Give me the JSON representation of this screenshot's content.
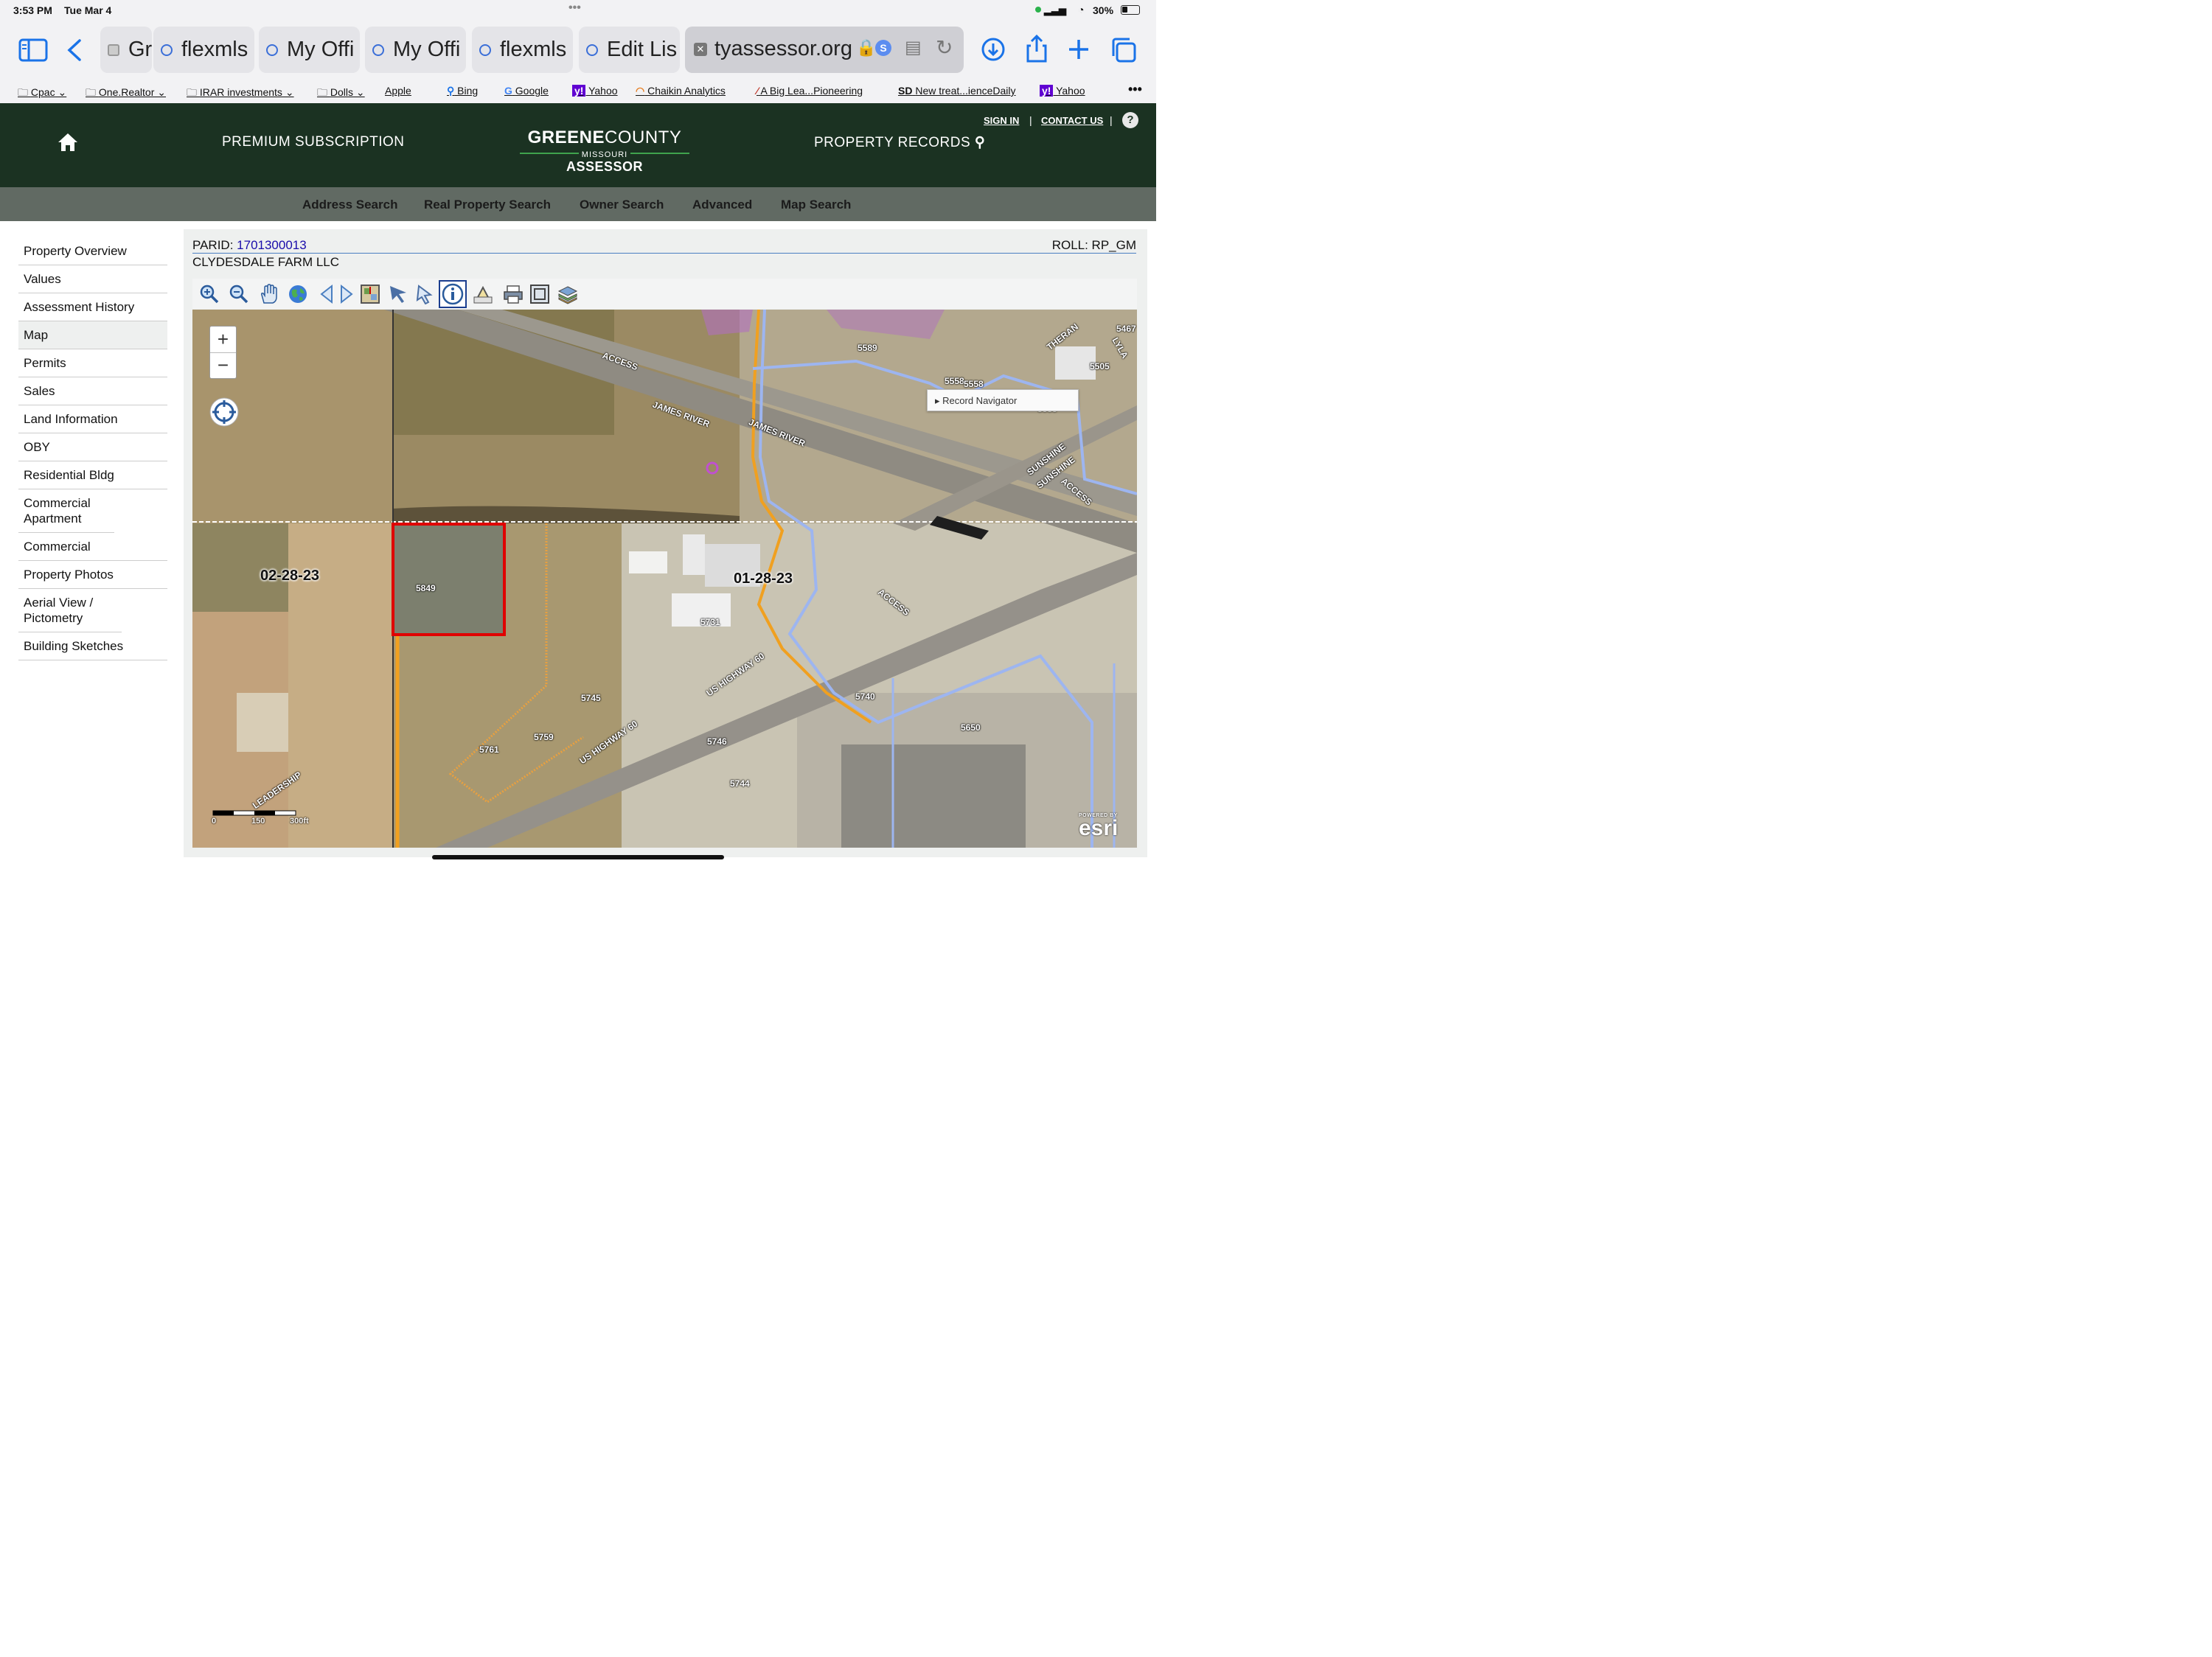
{
  "status_bar": {
    "time": "3:53 PM",
    "date": "Tue Mar 4",
    "battery": "30%"
  },
  "tabs": [
    {
      "label": "Gr"
    },
    {
      "label": "flexmls"
    },
    {
      "label": "My Offi"
    },
    {
      "label": "My Offi"
    },
    {
      "label": "flexmls"
    },
    {
      "label": "Edit Lis"
    },
    {
      "label": "tyassessor.org"
    }
  ],
  "bookmarks": [
    "Cpac",
    "One.Realtor",
    "IRAR investments",
    "Dolls",
    "Apple",
    "Bing",
    "Google",
    "Yahoo",
    "Chaikin Analytics",
    "A Big Lea...Pioneering",
    "New treat...ienceDaily",
    "Yahoo"
  ],
  "header": {
    "premium": "PREMIUM SUBSCRIPTION",
    "logo_green": "GREENE",
    "logo_county": "COUNTY",
    "logo_state": "MISSOURI",
    "logo_sub": "ASSESSOR",
    "property_records": "PROPERTY RECORDS",
    "sign_in": "SIGN IN",
    "sep": "|",
    "contact": "CONTACT US",
    "help": "?"
  },
  "subnav": [
    "Address Search",
    "Real Property Search",
    "Owner Search",
    "Advanced",
    "Map Search"
  ],
  "sidebar": [
    "Property Overview",
    "Values",
    "Assessment History",
    "Map",
    "Permits",
    "Sales",
    "Land Information",
    "OBY",
    "Residential Bldg",
    "Commercial Apartment",
    "Commercial",
    "Property Photos",
    "Aerial View / Pictometry",
    "Building Sketches"
  ],
  "parcel": {
    "parid_label": "PARID:",
    "parid": "1701300013",
    "roll": "ROLL: RP_GM",
    "owner": "CLYDESDALE FARM LLC"
  },
  "map": {
    "record_navigator": "Record Navigator",
    "zoom_in": "+",
    "zoom_out": "−",
    "section_left": "02-28-23",
    "section_right": "01-28-23",
    "scale": [
      "0",
      "150",
      "300ft"
    ],
    "esri_powered": "POWERED BY",
    "esri": "esri",
    "parcel_labels": [
      "5849",
      "5731",
      "5745",
      "5759",
      "5761",
      "5740",
      "5746",
      "5744",
      "5650",
      "5589",
      "5505",
      "5467",
      "5558",
      "5558",
      "5555"
    ],
    "road_labels": [
      "ACCESS",
      "JAMES RIVER",
      "JAMES RIVER",
      "SUNSHINE",
      "SUNSHINE",
      "ACCESS",
      "ACCESS",
      "US HIGHWAY 60",
      "US HIGHWAY 60",
      "LEADERSHIP",
      "THERAN",
      "LYLA"
    ]
  },
  "colors": {
    "header_bg": "#1b3222",
    "subnav_bg": "#616a63",
    "accent_green": "#3fa34d",
    "link_blue": "#1a0dab",
    "selected_parcel": "#e00000"
  }
}
